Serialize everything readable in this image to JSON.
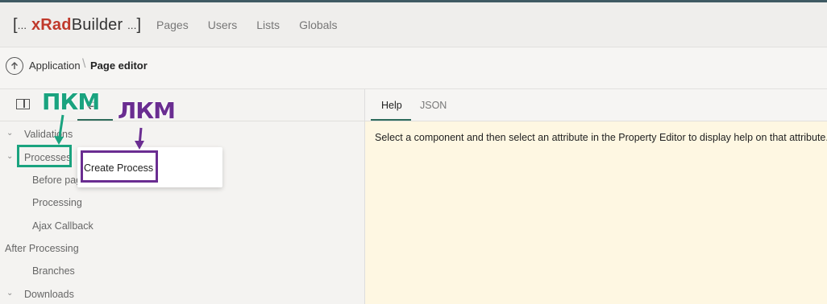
{
  "header": {
    "logo": {
      "open_bracket": "[",
      "dots_left": "...",
      "brand_red": "xRad",
      "brand_rest": "Builder",
      "dots_right": "...",
      "close_bracket": "]"
    },
    "nav": [
      "Pages",
      "Users",
      "Lists",
      "Globals"
    ]
  },
  "breadcrumb": {
    "up_icon": "arrow-up-circle-icon",
    "item1": "Application",
    "separator": "\\",
    "current": "Page editor"
  },
  "left_panel": {
    "tabs": [
      {
        "icon": "panel-icon"
      },
      {
        "icon": "sync-icon",
        "glyph": "⇄"
      }
    ],
    "tree": [
      {
        "label": "Validations",
        "chevron": "⌄"
      },
      {
        "label": "Processes",
        "chevron": "⌄"
      },
      {
        "label": "Before page"
      },
      {
        "label": "Processing"
      },
      {
        "label": "Ajax Callback"
      },
      {
        "label": "After Processing"
      },
      {
        "label": "Branches"
      },
      {
        "label": "Downloads",
        "chevron": "⌄"
      }
    ],
    "context_menu": {
      "items": [
        "Create Process"
      ]
    }
  },
  "annotations": {
    "right_click": "ПКМ",
    "left_click": "ЛКМ",
    "green": "#1aa37f",
    "purple": "#6a2d91"
  },
  "right_panel": {
    "tabs": [
      "Help",
      "JSON"
    ],
    "help_text": "Select a component and then select an attribute in the Property Editor to display help on that attribute."
  },
  "colors": {
    "accent": "#2e6b5b",
    "brand": "#c0392b",
    "help_bg": "#fef7e2"
  }
}
